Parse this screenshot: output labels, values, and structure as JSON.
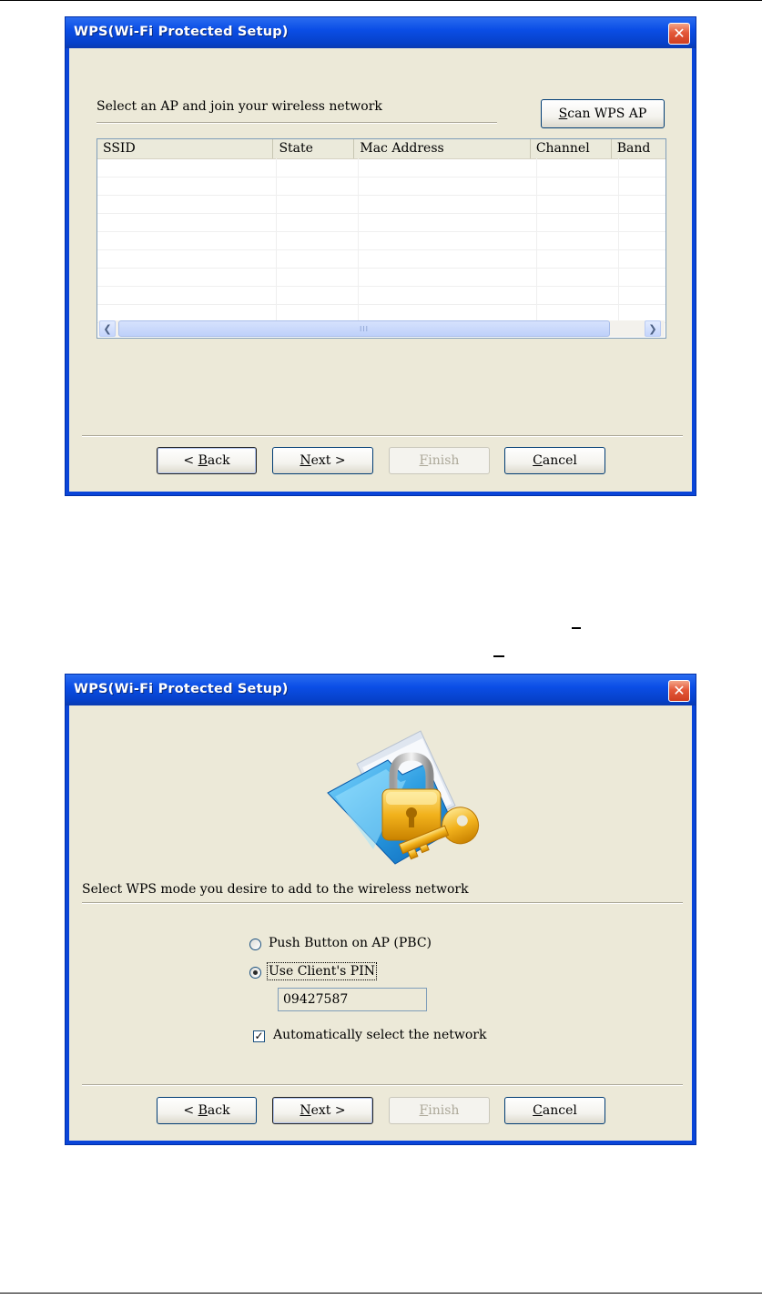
{
  "windows": [
    {
      "title": "WPS(Wi-Fi Protected Setup)",
      "close_glyph": "✕",
      "instruction": "Select an AP and join your wireless network",
      "scan_button": {
        "access": "S",
        "rest": "can WPS AP"
      },
      "table": {
        "columns": [
          "SSID",
          "State",
          "Mac Address",
          "Channel",
          "Band"
        ],
        "rows": []
      },
      "scroll_grip": "III",
      "buttons": {
        "back": {
          "prefix": "< ",
          "access": "B",
          "rest": "ack"
        },
        "next": {
          "access": "N",
          "rest": "ext >"
        },
        "finish": {
          "access": "F",
          "rest": "inish"
        },
        "cancel": {
          "access": "C",
          "rest": "ancel"
        }
      }
    },
    {
      "title": "WPS(Wi-Fi Protected Setup)",
      "close_glyph": "✕",
      "instruction": "Select WPS mode you desire to add to the wireless network",
      "options": {
        "pbc_label": "Push Button on AP (PBC)",
        "pin_label": "Use Client's PIN",
        "pin_value": "09427587",
        "auto_select_label": "Automatically select the network",
        "selected": "pin",
        "auto_select_checked": true
      },
      "buttons": {
        "back": {
          "prefix": "< ",
          "access": "B",
          "rest": "ack"
        },
        "next": {
          "access": "N",
          "rest": "ext >"
        },
        "finish": {
          "access": "F",
          "rest": "inish"
        },
        "cancel": {
          "access": "C",
          "rest": "ancel"
        }
      }
    }
  ],
  "icons": {
    "wps_illustration": "folder-padlock-key-icon"
  }
}
